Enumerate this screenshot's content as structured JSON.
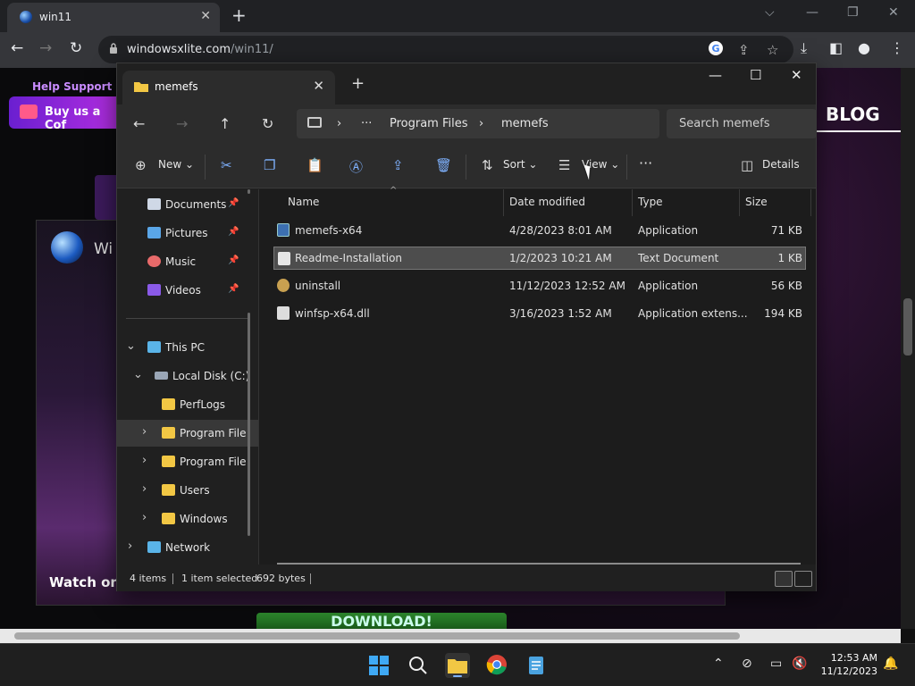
{
  "browser": {
    "tab_title": "win11",
    "url_host": "windowsxlite.com",
    "url_path": "/win11/"
  },
  "webpage": {
    "help_text": "Help Support",
    "coffee_button": "Buy us a Cof",
    "blog_label": "BLOG",
    "video_title": "Wi",
    "watch_on": "Watch on",
    "download_text": "DOWNLOAD!"
  },
  "explorer": {
    "tab_title": "memefs",
    "breadcrumb": [
      "Program Files",
      "memefs"
    ],
    "search_placeholder": "Search memefs",
    "commands": {
      "new": "New",
      "sort": "Sort",
      "view": "View",
      "details": "Details"
    },
    "sidebar": {
      "quick": [
        {
          "label": "Documents",
          "icon": "documents-icon",
          "color": "#cfd8e6"
        },
        {
          "label": "Pictures",
          "icon": "pictures-icon",
          "color": "#5aa6e8"
        },
        {
          "label": "Music",
          "icon": "music-icon",
          "color": "#e86a6a"
        },
        {
          "label": "Videos",
          "icon": "videos-icon",
          "color": "#8a5ae8"
        }
      ],
      "tree": {
        "this_pc": "This PC",
        "local_disk": "Local Disk (C:)",
        "perflogs": "PerfLogs",
        "program_files_1": "Program File",
        "program_files_2": "Program File",
        "users": "Users",
        "windows": "Windows",
        "network": "Network"
      }
    },
    "columns": {
      "name": "Name",
      "date": "Date modified",
      "type": "Type",
      "size": "Size"
    },
    "files": [
      {
        "name": "memefs-x64",
        "date": "4/28/2023 8:01 AM",
        "type": "Application",
        "size": "71 KB",
        "selected": false
      },
      {
        "name": "Readme-Installation",
        "date": "1/2/2023 10:21 AM",
        "type": "Text Document",
        "size": "1 KB",
        "selected": true
      },
      {
        "name": "uninstall",
        "date": "11/12/2023 12:52 AM",
        "type": "Application",
        "size": "56 KB",
        "selected": false
      },
      {
        "name": "winfsp-x64.dll",
        "date": "3/16/2023 1:52 AM",
        "type": "Application extens...",
        "size": "194 KB",
        "selected": false
      }
    ],
    "status": {
      "items": "4 items",
      "selected": "1 item selected",
      "bytes": "692 bytes"
    }
  },
  "taskbar": {
    "time": "12:53 AM",
    "date": "11/12/2023"
  },
  "colors": {
    "accent": "#7fb2ff",
    "folder": "#f2c744"
  }
}
